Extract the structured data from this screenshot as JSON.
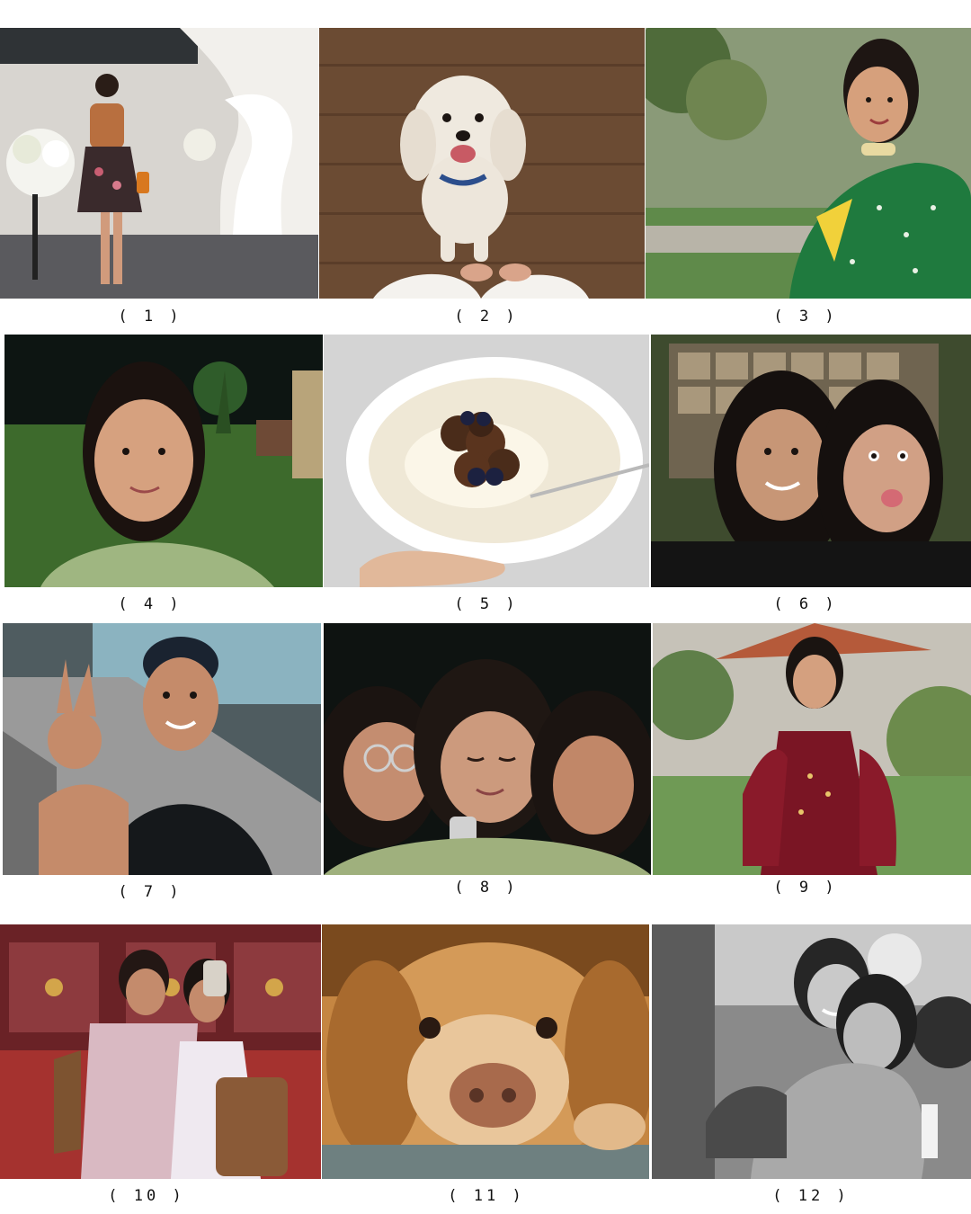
{
  "tiles": [
    {
      "id": "1",
      "label": "( 1 )",
      "subject": "woman mirror selfie in hallway with white flowers",
      "bg": "#d9d6d1",
      "accent": "#c98a5e"
    },
    {
      "id": "2",
      "label": "( 2 )",
      "subject": "white fluffy dog sitting on wooden floor",
      "bg": "#6b4a31",
      "accent": "#f1ece4"
    },
    {
      "id": "3",
      "label": "( 3 )",
      "subject": "woman in green saree seated outdoors",
      "bg": "#7f8f6a",
      "accent": "#1f7a3e"
    },
    {
      "id": "4",
      "label": "( 4 )",
      "subject": "night selfie on lawn with palm trees",
      "bg": "#1b2a1d",
      "accent": "#a9c08a"
    },
    {
      "id": "5",
      "label": "( 5 )",
      "subject": "bowl of yogurt with granola and blueberries",
      "bg": "#d5d5d5",
      "accent": "#4a2c1a"
    },
    {
      "id": "6",
      "label": "( 6 )",
      "subject": "two friends selfie, one sticking out tongue",
      "bg": "#3d4a2e",
      "accent": "#caa08d"
    },
    {
      "id": "7",
      "label": "( 7 )",
      "subject": "swimmer with cap making peace sign by pool",
      "bg": "#8d9aa0",
      "accent": "#c98a62"
    },
    {
      "id": "8",
      "label": "( 8 )",
      "subject": "three friends close-up selfie at night",
      "bg": "#0f1414",
      "accent": "#c08a6e"
    },
    {
      "id": "9",
      "label": "( 9 )",
      "subject": "woman in maroon suit in garden",
      "bg": "#6f8a5a",
      "accent": "#7a1524"
    },
    {
      "id": "10",
      "label": "( 10 )",
      "subject": "two women mirror selfie in jewellery store",
      "bg": "#7b2a2e",
      "accent": "#d9b9c2"
    },
    {
      "id": "11",
      "label": "( 11 )",
      "subject": "golden dog face close-up resting on cushion",
      "bg": "#c98a45",
      "accent": "#a86a4c"
    },
    {
      "id": "12",
      "label": "( 12 )",
      "subject": "black and white photo of two women hugging",
      "bg": "#7b7b7b",
      "accent": "#d8d8d8"
    }
  ]
}
